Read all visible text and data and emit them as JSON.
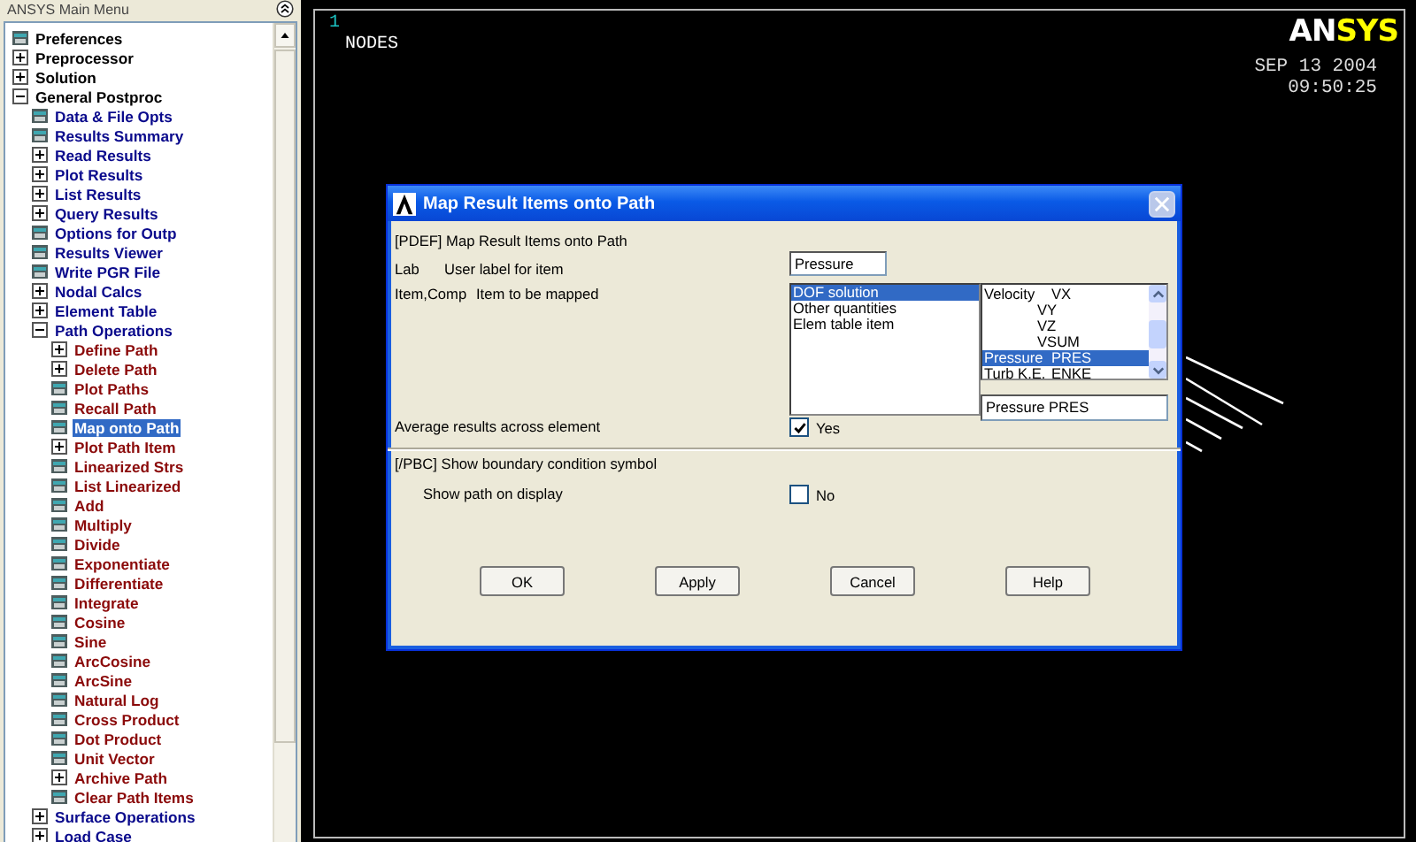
{
  "main_menu": {
    "title": "ANSYS Main Menu",
    "tree": [
      {
        "label": "Preferences",
        "kind": "command",
        "selected": false
      },
      {
        "label": "Preprocessor",
        "kind": "folder",
        "expanded": false,
        "selected": false
      },
      {
        "label": "Solution",
        "kind": "folder",
        "expanded": false,
        "selected": false
      },
      {
        "label": "General Postproc",
        "kind": "folder",
        "expanded": true,
        "selected": false,
        "children": [
          {
            "label": "Data & File Opts",
            "kind": "command",
            "selected": false
          },
          {
            "label": "Results Summary",
            "kind": "command",
            "selected": false
          },
          {
            "label": "Read Results",
            "kind": "folder",
            "expanded": false,
            "selected": false
          },
          {
            "label": "Plot Results",
            "kind": "folder",
            "expanded": false,
            "selected": false
          },
          {
            "label": "List Results",
            "kind": "folder",
            "expanded": false,
            "selected": false
          },
          {
            "label": "Query Results",
            "kind": "folder",
            "expanded": false,
            "selected": false
          },
          {
            "label": "Options for Outp",
            "kind": "command",
            "selected": false
          },
          {
            "label": "Results Viewer",
            "kind": "command",
            "selected": false
          },
          {
            "label": "Write PGR File",
            "kind": "command",
            "selected": false
          },
          {
            "label": "Nodal Calcs",
            "kind": "folder",
            "expanded": false,
            "selected": false
          },
          {
            "label": "Element Table",
            "kind": "folder",
            "expanded": false,
            "selected": false
          },
          {
            "label": "Path Operations",
            "kind": "folder",
            "expanded": true,
            "selected": false,
            "children": [
              {
                "label": "Define Path",
                "kind": "folder",
                "expanded": false,
                "selected": false
              },
              {
                "label": "Delete Path",
                "kind": "folder",
                "expanded": false,
                "selected": false
              },
              {
                "label": "Plot Paths",
                "kind": "command",
                "selected": false
              },
              {
                "label": "Recall Path",
                "kind": "command",
                "selected": false
              },
              {
                "label": "Map onto Path",
                "kind": "command",
                "selected": true
              },
              {
                "label": "Plot Path Item",
                "kind": "folder",
                "expanded": false,
                "selected": false
              },
              {
                "label": "Linearized Strs",
                "kind": "command",
                "selected": false
              },
              {
                "label": "List Linearized",
                "kind": "command",
                "selected": false
              },
              {
                "label": "Add",
                "kind": "command",
                "selected": false
              },
              {
                "label": "Multiply",
                "kind": "command",
                "selected": false
              },
              {
                "label": "Divide",
                "kind": "command",
                "selected": false
              },
              {
                "label": "Exponentiate",
                "kind": "command",
                "selected": false
              },
              {
                "label": "Differentiate",
                "kind": "command",
                "selected": false
              },
              {
                "label": "Integrate",
                "kind": "command",
                "selected": false
              },
              {
                "label": "Cosine",
                "kind": "command",
                "selected": false
              },
              {
                "label": "Sine",
                "kind": "command",
                "selected": false
              },
              {
                "label": "ArcCosine",
                "kind": "command",
                "selected": false
              },
              {
                "label": "ArcSine",
                "kind": "command",
                "selected": false
              },
              {
                "label": "Natural Log",
                "kind": "command",
                "selected": false
              },
              {
                "label": "Cross Product",
                "kind": "command",
                "selected": false
              },
              {
                "label": "Dot Product",
                "kind": "command",
                "selected": false
              },
              {
                "label": "Unit Vector",
                "kind": "command",
                "selected": false
              },
              {
                "label": "Archive Path",
                "kind": "folder",
                "expanded": false,
                "selected": false
              },
              {
                "label": "Clear Path Items",
                "kind": "command",
                "selected": false
              }
            ]
          },
          {
            "label": "Surface Operations",
            "kind": "folder",
            "expanded": false,
            "selected": false
          },
          {
            "label": "Load Case",
            "kind": "folder",
            "expanded": false,
            "selected": false
          }
        ]
      }
    ]
  },
  "graphics": {
    "window_number": "1",
    "plot_label": "NODES",
    "logo": [
      {
        "text": "AN",
        "color": "#ffffff"
      },
      {
        "text": "SYS",
        "color": "#ffff00"
      }
    ],
    "date": "SEP 13 2004",
    "time": "09:50:25"
  },
  "dialog": {
    "title": "Map Result Items onto Path",
    "command": "[PDEF]  Map Result Items onto Path",
    "lab": {
      "key": "Lab",
      "label": "User label for item",
      "value": "Pressure"
    },
    "item": {
      "key": "Item,Comp",
      "label": "Item to be mapped",
      "categories": [
        {
          "label": "DOF solution",
          "selected": true
        },
        {
          "label": "Other quantities",
          "selected": false
        },
        {
          "label": "Elem table item",
          "selected": false
        }
      ],
      "components": [
        {
          "name": "Velocity",
          "comp": "VX",
          "selected": false
        },
        {
          "comp": "VY",
          "selected": false
        },
        {
          "comp": "VZ",
          "selected": false
        },
        {
          "comp": "VSUM",
          "selected": false
        },
        {
          "name": "Pressure",
          "comp": "PRES",
          "selected": true
        },
        {
          "name": "Turb K.E.",
          "comp": "ENKE",
          "selected": false
        }
      ],
      "choice": "Pressure    PRES"
    },
    "average": {
      "label": "Average results across element",
      "checked": true,
      "state": "Yes"
    },
    "pbc": "[/PBC]  Show boundary condition symbol",
    "show_path": {
      "label": "Show path on display",
      "checked": false,
      "state": "No"
    },
    "buttons": [
      "OK",
      "Apply",
      "Cancel",
      "Help"
    ]
  }
}
